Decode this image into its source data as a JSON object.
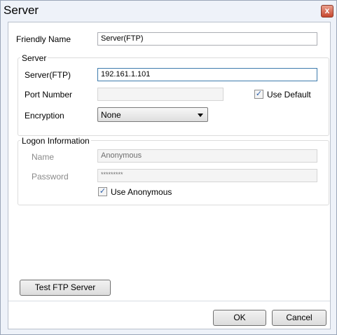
{
  "window": {
    "title": "Server",
    "close_label": "x"
  },
  "friendly_name": {
    "label": "Friendly Name",
    "value": "Server(FTP)"
  },
  "server_group": {
    "title": "Server",
    "server_label": "Server(FTP)",
    "server_value": "192.161.1.101",
    "port_label": "Port Number",
    "port_value": "",
    "use_default_label": "Use Default",
    "use_default_checked": true,
    "encryption_label": "Encryption",
    "encryption_value": "None"
  },
  "logon_group": {
    "title": "Logon Information",
    "name_label": "Name",
    "name_value": "Anonymous",
    "password_label": "Password",
    "password_value": "*********",
    "use_anonymous_label": "Use Anonymous",
    "use_anonymous_checked": true
  },
  "buttons": {
    "test_label": "Test FTP Server",
    "ok_label": "OK",
    "cancel_label": "Cancel"
  }
}
